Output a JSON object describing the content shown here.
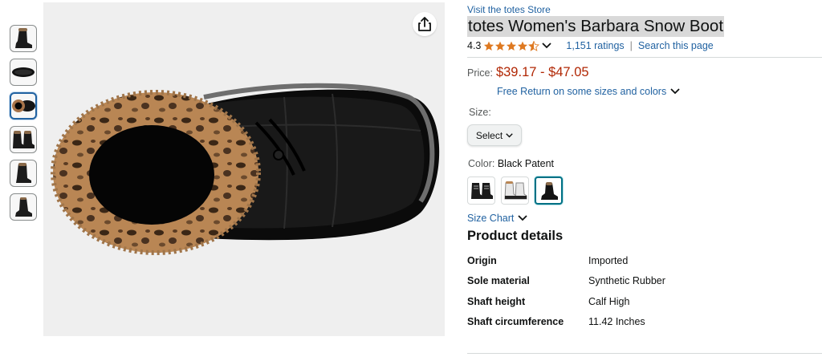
{
  "store_link": "Visit the totes Store",
  "title": "totes Women's Barbara Snow Boot",
  "rating": {
    "value": "4.3",
    "stars": 4.3,
    "ratings_link": "1,151 ratings",
    "separator": "|",
    "search_link": "Search this page"
  },
  "price": {
    "label": "Price:",
    "range": "$39.17 - $47.05",
    "free_return": "Free Return on some sizes and colors"
  },
  "size": {
    "label": "Size:",
    "select_label": "Select"
  },
  "color": {
    "label": "Color:",
    "value": "Black Patent"
  },
  "size_chart": "Size Chart",
  "product_details": {
    "heading": "Product details",
    "rows": [
      {
        "key": "Origin",
        "value": "Imported"
      },
      {
        "key": "Sole material",
        "value": "Synthetic Rubber"
      },
      {
        "key": "Shaft height",
        "value": "Calf High"
      },
      {
        "key": "Shaft circumference",
        "value": "11.42 Inches"
      }
    ]
  },
  "colors": {
    "link": "#2162a1",
    "price": "#b12704",
    "star": "#de7921",
    "selected_border": "#007185"
  }
}
